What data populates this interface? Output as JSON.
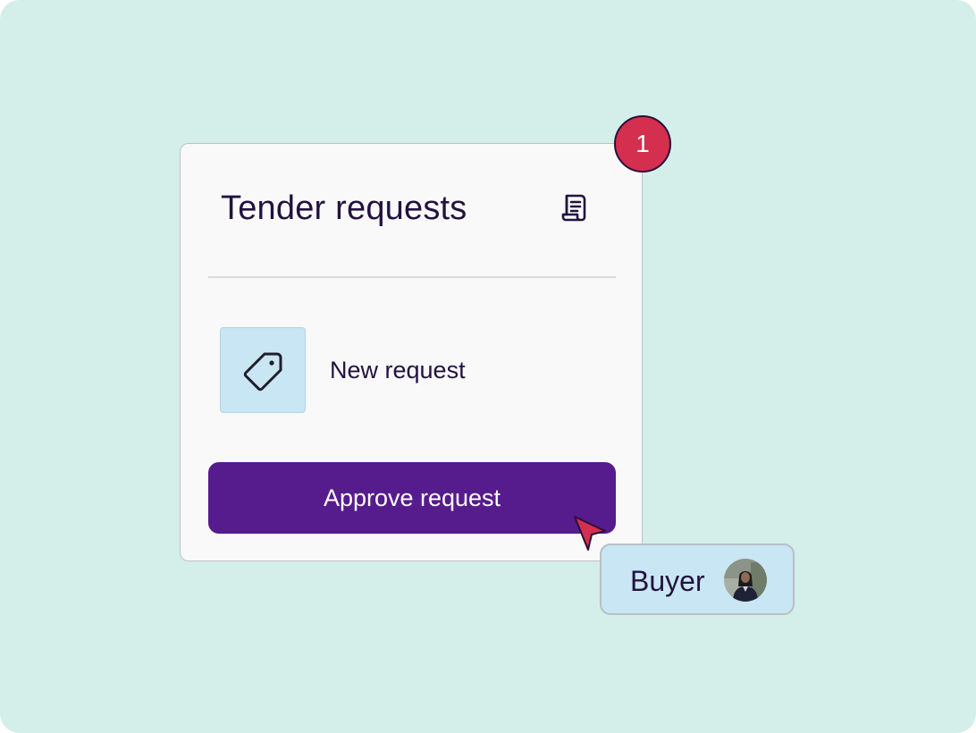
{
  "card": {
    "title": "Tender requests",
    "title_icon": "document-icon",
    "item": {
      "label": "New request",
      "icon": "tag-icon"
    },
    "approve_label": "Approve request"
  },
  "notification_badge": {
    "count": "1",
    "color": "#d42f4f"
  },
  "cursor_icon": "pointer-cursor-icon",
  "user": {
    "role": "Buyer",
    "avatar_icon": "avatar-photo"
  },
  "colors": {
    "background": "#d4eee9",
    "card": "#f9f9f9",
    "primary": "#561b8c",
    "text": "#22123f",
    "chip": "#c9e6f4",
    "cursor": "#d42f4f"
  }
}
